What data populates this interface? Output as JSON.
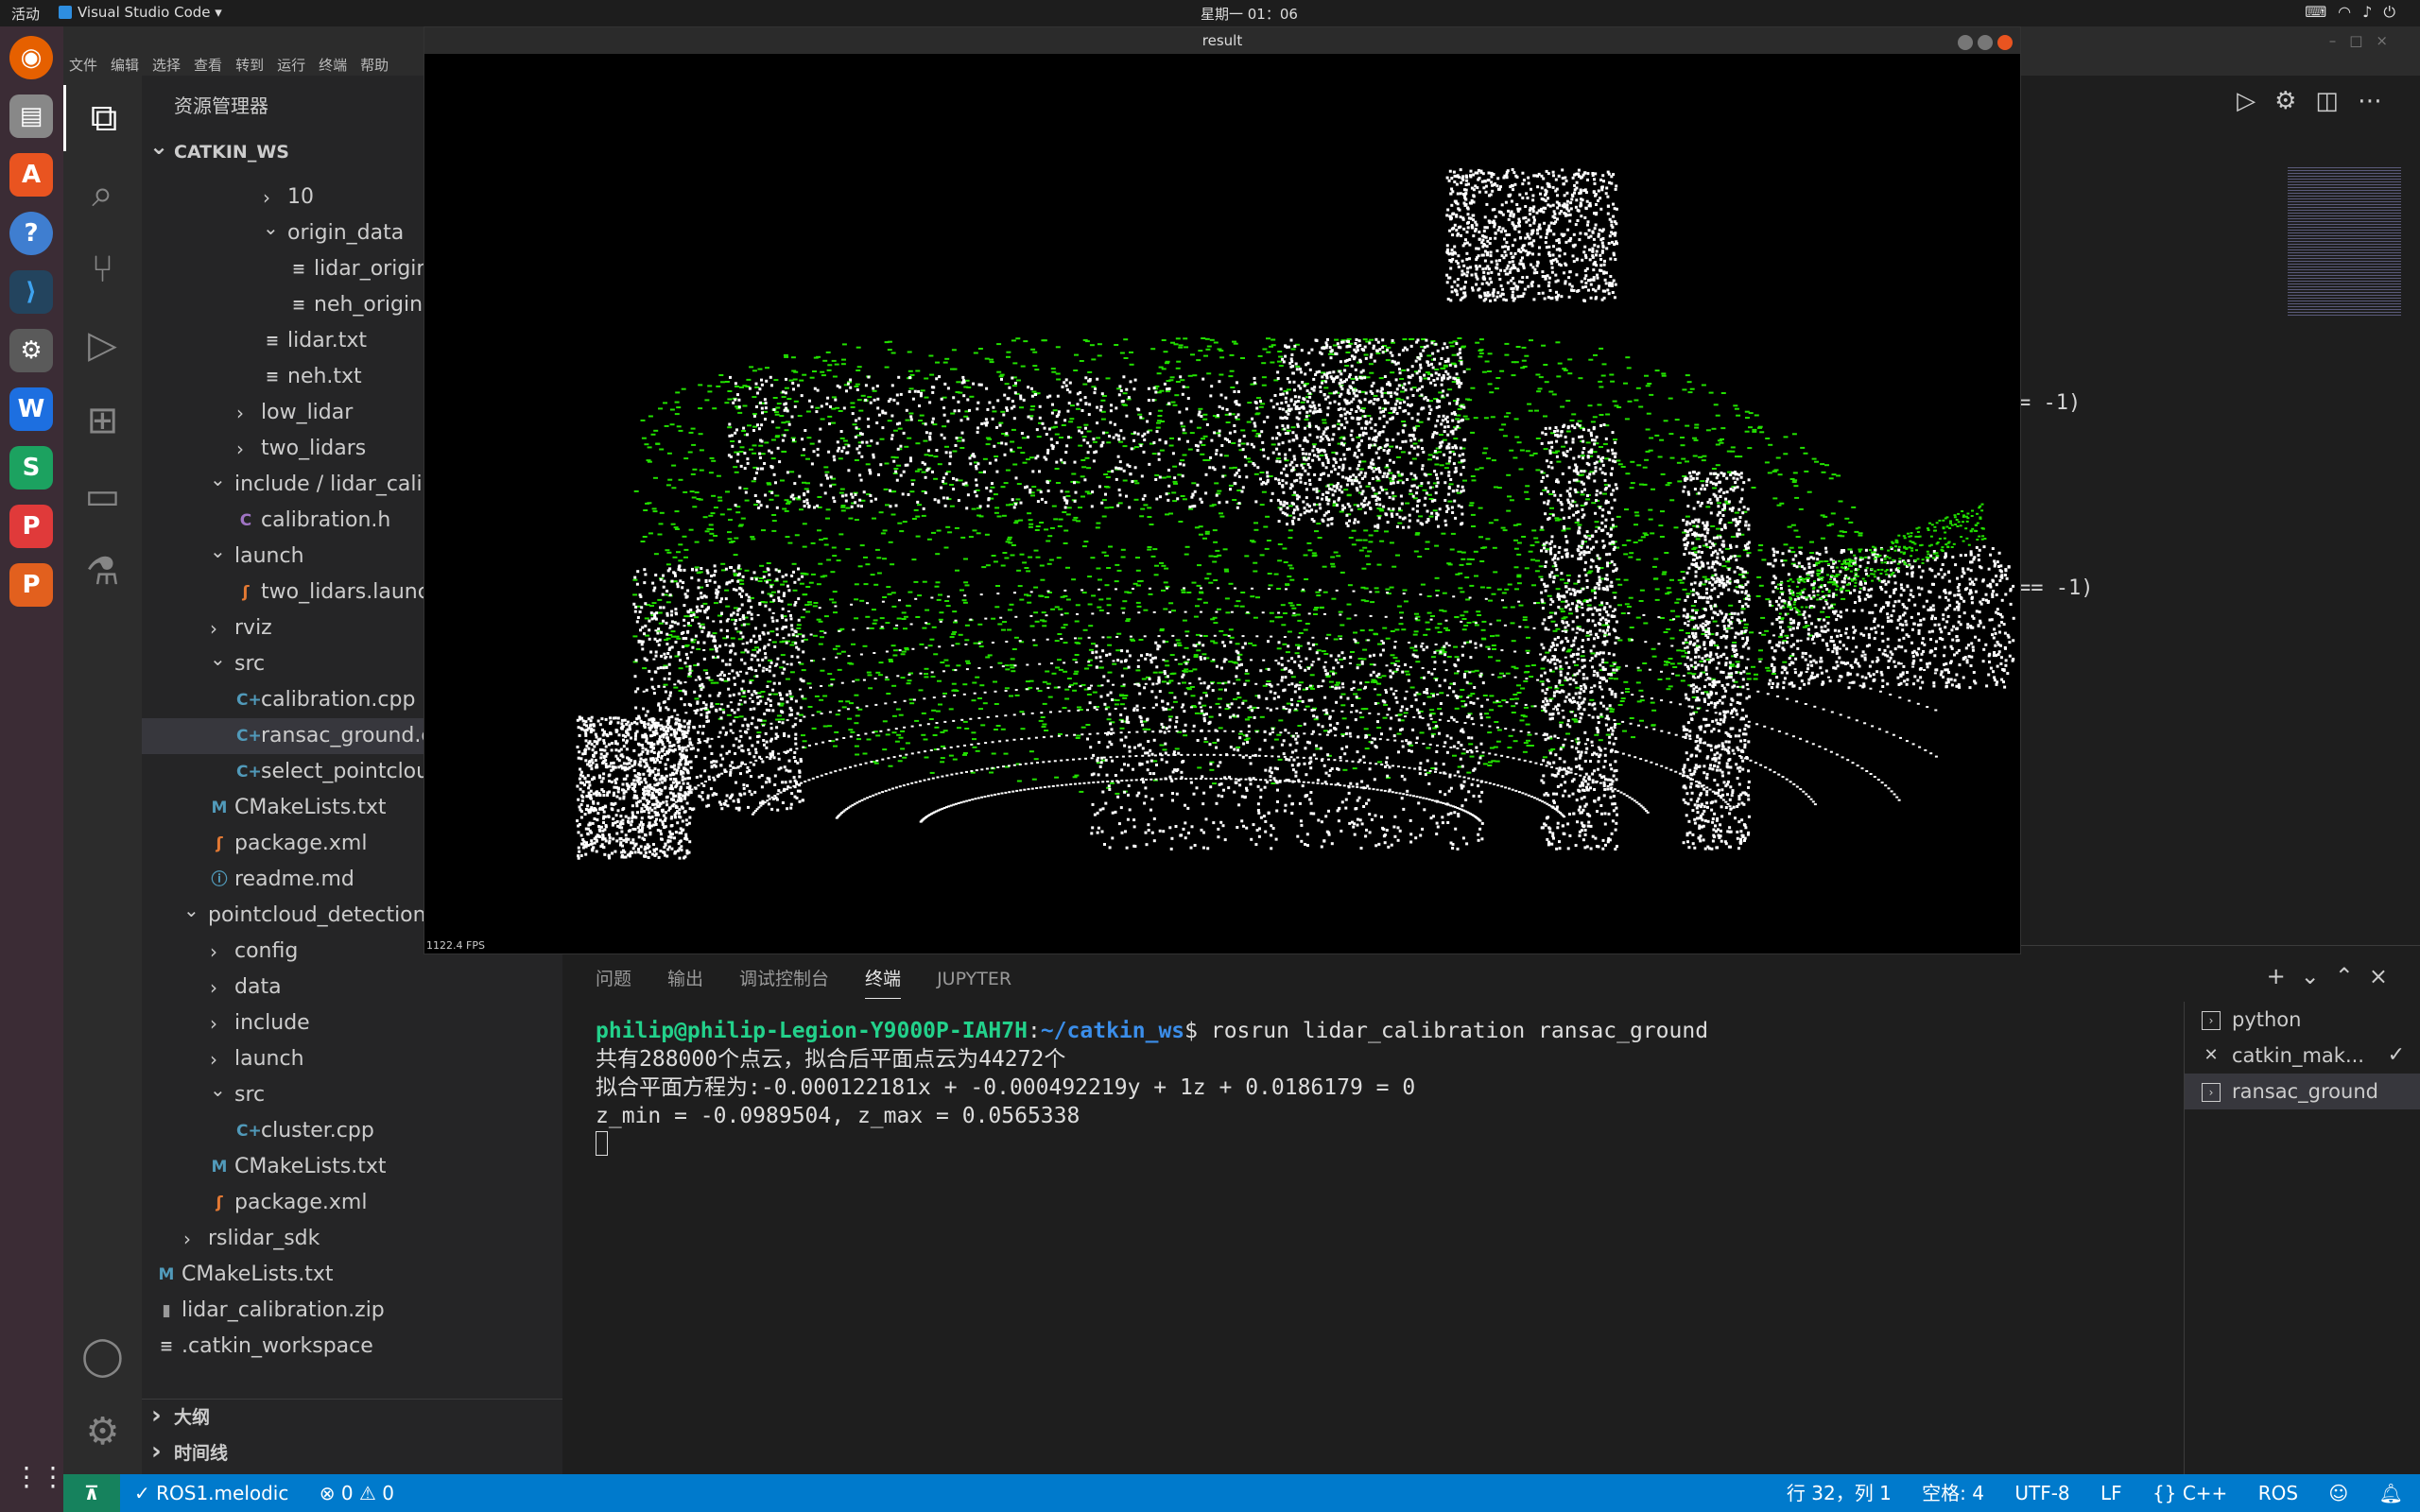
{
  "top_bar": {
    "activities": "活动",
    "app_name": "Visual Studio Code ▾",
    "clock": "星期一 01：06"
  },
  "vscode": {
    "menu": [
      "文件",
      "编辑",
      "选择",
      "查看",
      "转到",
      "运行",
      "终端",
      "帮助"
    ],
    "sidebar": {
      "header": "资源管理器",
      "workspace": "CATKIN_WS",
      "tree": [
        {
          "label": "10",
          "indent": 3,
          "kind": "folder",
          "open": false
        },
        {
          "label": "origin_data",
          "indent": 3,
          "kind": "folder",
          "open": true
        },
        {
          "label": "lidar_origin.txt",
          "indent": 4,
          "kind": "txt"
        },
        {
          "label": "neh_origin.txt",
          "indent": 4,
          "kind": "txt"
        },
        {
          "label": "lidar.txt",
          "indent": 3,
          "kind": "txt"
        },
        {
          "label": "neh.txt",
          "indent": 3,
          "kind": "txt"
        },
        {
          "label": "low_lidar",
          "indent": 2,
          "kind": "folder",
          "open": false
        },
        {
          "label": "two_lidars",
          "indent": 2,
          "kind": "folder",
          "open": false
        },
        {
          "label": "include / lidar_calibra",
          "indent": 1,
          "kind": "folder",
          "open": true
        },
        {
          "label": "calibration.h",
          "indent": 2,
          "kind": "c"
        },
        {
          "label": "launch",
          "indent": 1,
          "kind": "folder",
          "open": true
        },
        {
          "label": "two_lidars.launch",
          "indent": 2,
          "kind": "rss"
        },
        {
          "label": "rviz",
          "indent": 1,
          "kind": "folder",
          "open": false
        },
        {
          "label": "src",
          "indent": 1,
          "kind": "folder",
          "open": true
        },
        {
          "label": "calibration.cpp",
          "indent": 2,
          "kind": "cpp"
        },
        {
          "label": "ransac_ground.cpp",
          "indent": 2,
          "kind": "cpp",
          "selected": true
        },
        {
          "label": "select_pointcloud.c",
          "indent": 2,
          "kind": "cpp"
        },
        {
          "label": "CMakeLists.txt",
          "indent": 1,
          "kind": "m"
        },
        {
          "label": "package.xml",
          "indent": 1,
          "kind": "rss"
        },
        {
          "label": "readme.md",
          "indent": 1,
          "kind": "info"
        },
        {
          "label": "pointcloud_detection",
          "indent": 0,
          "kind": "folder",
          "open": true
        },
        {
          "label": "config",
          "indent": 1,
          "kind": "folder",
          "open": false
        },
        {
          "label": "data",
          "indent": 1,
          "kind": "folder",
          "open": false
        },
        {
          "label": "include",
          "indent": 1,
          "kind": "folder",
          "open": false
        },
        {
          "label": "launch",
          "indent": 1,
          "kind": "folder",
          "open": false
        },
        {
          "label": "src",
          "indent": 1,
          "kind": "folder",
          "open": true
        },
        {
          "label": "cluster.cpp",
          "indent": 2,
          "kind": "cpp"
        },
        {
          "label": "CMakeLists.txt",
          "indent": 1,
          "kind": "m"
        },
        {
          "label": "package.xml",
          "indent": 1,
          "kind": "rss"
        },
        {
          "label": "rslidar_sdk",
          "indent": 0,
          "kind": "folder",
          "open": false
        },
        {
          "label": "CMakeLists.txt",
          "indent": -1,
          "kind": "m"
        },
        {
          "label": "lidar_calibration.zip",
          "indent": -1,
          "kind": "zip"
        },
        {
          "label": ".catkin_workspace",
          "indent": -1,
          "kind": "txt"
        }
      ],
      "outline": "大纲",
      "timeline": "时间线"
    },
    "editor_snippets": [
      "= -1)",
      "== -1)"
    ],
    "panel": {
      "tabs": [
        "问题",
        "输出",
        "调试控制台",
        "终端",
        "JUPYTER"
      ],
      "active_tab": "终端",
      "terminal": {
        "prompt_user": "philip@philip-Legion-Y9000P-IAH7H",
        "prompt_path": "~/catkin_ws",
        "command": "$ rosrun lidar_calibration ransac_ground",
        "lines": [
          "共有288000个点云，拟合后平面点云为44272个",
          "拟合平面方程为:-0.000122181x + -0.000492219y + 1z + 0.0186179 = 0",
          "z_min = -0.0989504, z_max = 0.0565338"
        ]
      },
      "terminals": [
        {
          "label": "python"
        },
        {
          "label": "catkin_mak..."
        },
        {
          "label": "ransac_ground",
          "active": true
        }
      ]
    },
    "status": {
      "remote": "⊼",
      "ros": "✓ ROS1.melodic",
      "problems": "⊗ 0 ⚠ 0",
      "position": "行 32，列 1",
      "spaces": "空格: 4",
      "encoding": "UTF-8",
      "eol": "LF",
      "lang": "{} C++",
      "ext": "ROS"
    }
  },
  "result_window": {
    "title": "result",
    "fps": "1122.4 FPS"
  },
  "colors": {
    "ground": "#22e000",
    "points": "#ffffff",
    "statusbar": "#007acc"
  }
}
